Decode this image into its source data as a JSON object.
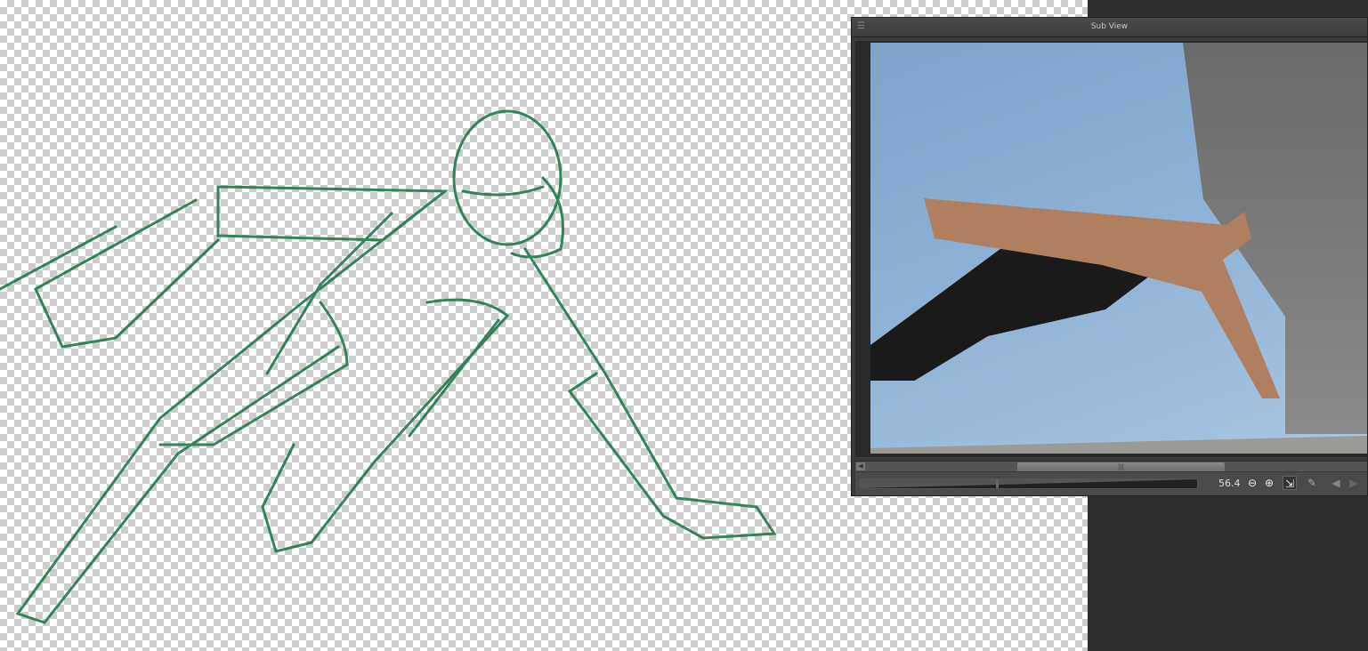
{
  "subview": {
    "title": "Sub View",
    "zoom_value": "56.4",
    "zoom_fraction": 0.4,
    "scroll_fraction": 0.33
  },
  "colors": {
    "sketch_stroke": "#1f7a4a",
    "panel_bg": "#3a3a3a"
  },
  "icons": [
    "menu-icon",
    "zoom-out-icon",
    "zoom-in-icon",
    "fit-view-icon",
    "eyedropper-icon",
    "prev-icon",
    "next-icon"
  ]
}
